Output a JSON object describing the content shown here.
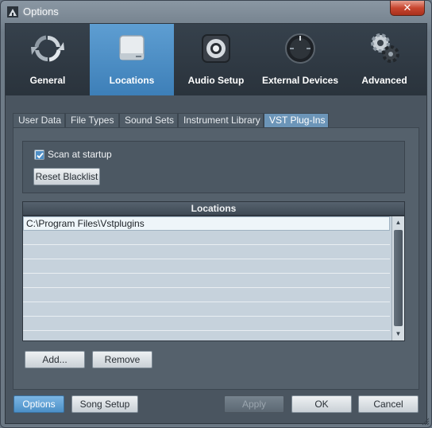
{
  "window": {
    "title": "Options",
    "close_label": "✕"
  },
  "categories": [
    {
      "label": "General",
      "icon": "refresh-arrows-icon"
    },
    {
      "label": "Locations",
      "icon": "drive-icon"
    },
    {
      "label": "Audio Setup",
      "icon": "speaker-icon"
    },
    {
      "label": "External Devices",
      "icon": "knob-icon"
    },
    {
      "label": "Advanced",
      "icon": "gears-icon"
    }
  ],
  "active_category": "Locations",
  "tabs": [
    {
      "label": "User Data"
    },
    {
      "label": "File Types"
    },
    {
      "label": "Sound Sets"
    },
    {
      "label": "Instrument Library"
    },
    {
      "label": "VST Plug-Ins"
    }
  ],
  "active_tab": "VST Plug-Ins",
  "vst": {
    "scan_label": "Scan at startup",
    "scan_checked": true,
    "reset_label": "Reset Blacklist",
    "locations_header": "Locations",
    "locations": [
      "C:\\Program Files\\Vstplugins"
    ],
    "add_label": "Add...",
    "remove_label": "Remove"
  },
  "footer": {
    "options_label": "Options",
    "song_setup_label": "Song Setup",
    "apply_label": "Apply",
    "ok_label": "OK",
    "cancel_label": "Cancel"
  },
  "colors": {
    "accent": "#4b8fc7",
    "active_tab": "#6c95b8"
  }
}
